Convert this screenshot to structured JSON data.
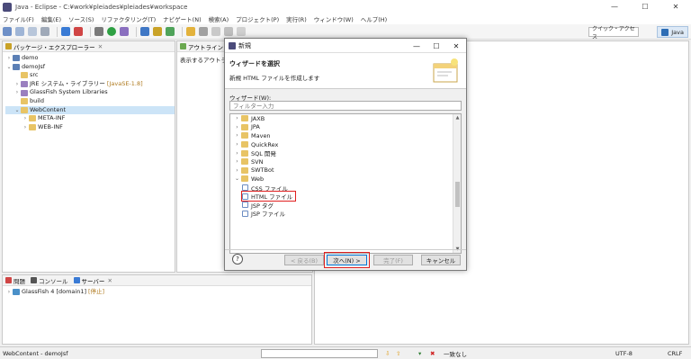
{
  "window": {
    "title": "Java - Eclipse - C:¥work¥pleiades¥pleiades¥workspace"
  },
  "menu": [
    "ファイル(F)",
    "編集(E)",
    "ソース(S)",
    "リファクタリング(T)",
    "ナビゲート(N)",
    "検索(A)",
    "プロジェクト(P)",
    "実行(R)",
    "ウィンドウ(W)",
    "ヘルプ(H)"
  ],
  "toolbar": {
    "quick_access": "クイック・アクセス",
    "perspective": "Java"
  },
  "package_explorer": {
    "tab_label": "パッケージ・エクスプローラー",
    "tree": [
      {
        "label": "demo",
        "level": 0,
        "arrow": "›",
        "icon": "project"
      },
      {
        "label": "demoJsf",
        "level": 0,
        "arrow": "⌄",
        "icon": "project"
      },
      {
        "label": "src",
        "level": 1,
        "arrow": "",
        "icon": "folder"
      },
      {
        "label": "JRE システム・ライブラリー",
        "tag": "[JavaSE-1.8]",
        "level": 1,
        "arrow": "›",
        "icon": "library"
      },
      {
        "label": "GlassFish System Libraries",
        "level": 1,
        "arrow": "›",
        "icon": "library"
      },
      {
        "label": "build",
        "level": 1,
        "arrow": "",
        "icon": "folder"
      },
      {
        "label": "WebContent",
        "level": 1,
        "arrow": "⌄",
        "icon": "folder",
        "selected": true
      },
      {
        "label": "META-INF",
        "level": 2,
        "arrow": "›",
        "icon": "folder"
      },
      {
        "label": "WEB-INF",
        "level": 2,
        "arrow": "›",
        "icon": "folder"
      }
    ]
  },
  "outline": {
    "tab_label": "アウトライン",
    "message": "表示するアウトライン"
  },
  "bottom_panel": {
    "tabs": [
      "問題",
      "コンソール",
      "サーバー"
    ],
    "server_entry": "GlassFish 4 [domain1]",
    "server_status": "[停止]"
  },
  "statusbar": {
    "left": "WebContent - demoJsf",
    "no_match": "一致なし",
    "encoding": "UTF-8",
    "line_ending": "CRLF"
  },
  "dialog": {
    "title": "新規",
    "header_title": "ウィザードを選択",
    "header_desc": "新規 HTML ファイルを作成します",
    "wizard_label": "ウィザード(W):",
    "filter_placeholder": "フィルター入力",
    "items": [
      {
        "label": "JAXB",
        "level": 0,
        "arrow": "›",
        "icon": "folder"
      },
      {
        "label": "JPA",
        "level": 0,
        "arrow": "›",
        "icon": "folder"
      },
      {
        "label": "Maven",
        "level": 0,
        "arrow": "›",
        "icon": "folder"
      },
      {
        "label": "QuickRex",
        "level": 0,
        "arrow": "›",
        "icon": "folder"
      },
      {
        "label": "SQL 開発",
        "level": 0,
        "arrow": "›",
        "icon": "folder"
      },
      {
        "label": "SVN",
        "level": 0,
        "arrow": "›",
        "icon": "folder"
      },
      {
        "label": "SWTBot",
        "level": 0,
        "arrow": "›",
        "icon": "folder"
      },
      {
        "label": "Web",
        "level": 0,
        "arrow": "⌄",
        "icon": "folder"
      },
      {
        "label": "CSS ファイル",
        "level": 1,
        "arrow": "",
        "icon": "file"
      },
      {
        "label": "HTML ファイル",
        "level": 1,
        "arrow": "",
        "icon": "file",
        "highlighted": true
      },
      {
        "label": "JSP タグ",
        "level": 1,
        "arrow": "",
        "icon": "file"
      },
      {
        "label": "JSP ファイル",
        "level": 1,
        "arrow": "",
        "icon": "file"
      }
    ],
    "buttons": {
      "back": "< 戻る(B)",
      "next": "次へ(N) >",
      "finish": "完了(F)",
      "cancel": "キャンセル"
    },
    "help": "?"
  }
}
